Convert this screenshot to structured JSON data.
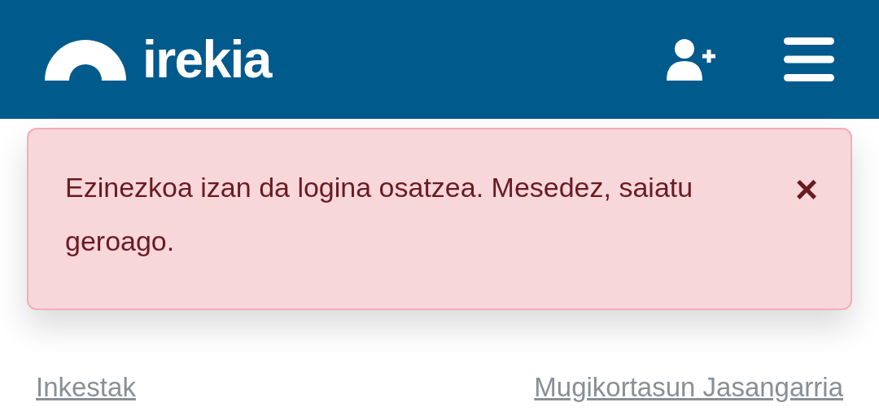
{
  "header": {
    "logo_text": "irekia"
  },
  "alert": {
    "message": "Ezinezkoa izan da logina osatzea. Mesedez, saiatu geroago.",
    "close": "×"
  },
  "links": [
    {
      "label": "Inkestak"
    },
    {
      "label": "Mugikortasun Jasangarria"
    }
  ]
}
